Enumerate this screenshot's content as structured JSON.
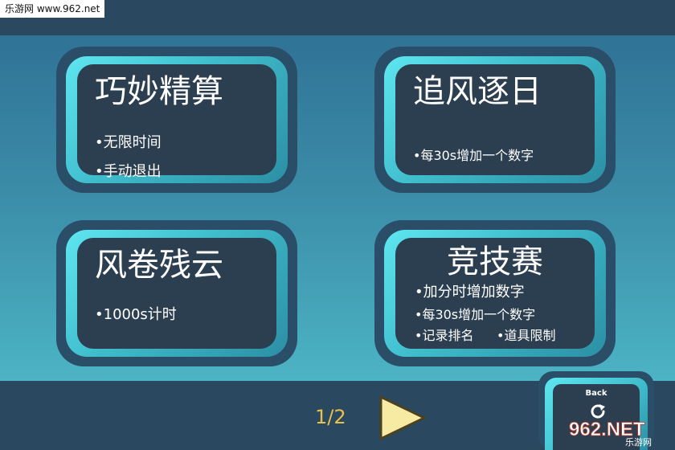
{
  "watermark": {
    "top_text": "乐游网 www.962.net",
    "bottom_main": "962.NET",
    "bottom_sub": "乐游网"
  },
  "modes": [
    {
      "title": "巧妙精算",
      "bullets": [
        "•无限时间",
        "•手动退出"
      ]
    },
    {
      "title": "追风逐日",
      "bullets": [
        "•每30s增加一个数字"
      ]
    },
    {
      "title": "风卷残云",
      "bullets": [
        "•1000s计时"
      ]
    },
    {
      "title": "竞技赛",
      "bullets": [
        "•加分时增加数字",
        "•每30s增加一个数字",
        "•记录排名",
        "•道具限制"
      ]
    }
  ],
  "pager": {
    "indicator": "1/2",
    "next_icon": "play-triangle-icon"
  },
  "back_button": {
    "label": "Back",
    "icon": "refresh-icon"
  },
  "colors": {
    "bar": "#2a4860",
    "card_inner": "#2c3f51",
    "card_frame": "#4fd6e2",
    "accent_yellow": "#e8c04a",
    "arrow_fill": "#f7eba3"
  }
}
